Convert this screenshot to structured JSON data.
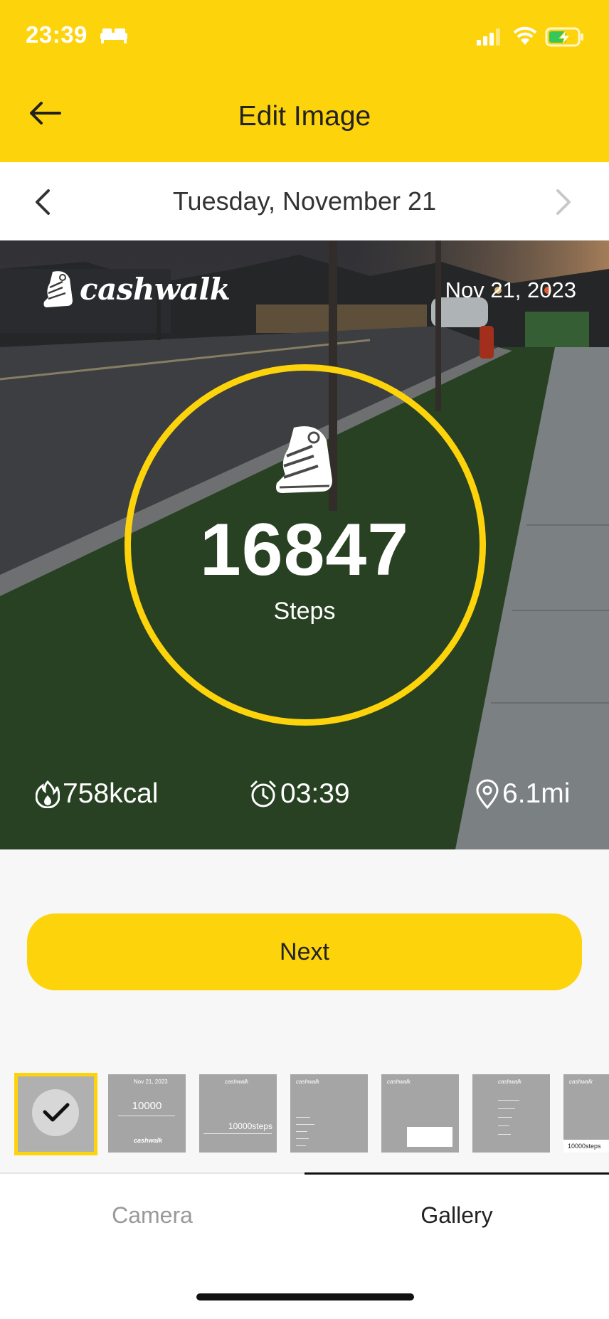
{
  "status_bar": {
    "time": "23:39"
  },
  "header": {
    "title": "Edit Image"
  },
  "date_nav": {
    "label": "Tuesday, November 21"
  },
  "photo": {
    "brand": "cashwalk",
    "date": "Nov 21, 2023",
    "steps": "16847",
    "steps_label": "Steps",
    "calories": "758kcal",
    "duration": "03:39",
    "distance": "6.1mi"
  },
  "actions": {
    "next_label": "Next"
  },
  "templates": {
    "t2_value": "10000",
    "t3_value": "10000steps",
    "t7_value": "10000steps"
  },
  "tabs": [
    {
      "label": "Camera",
      "active": false
    },
    {
      "label": "Gallery",
      "active": true
    }
  ],
  "colors": {
    "accent": "#fdd30c",
    "text": "#222222",
    "muted": "#999999"
  }
}
